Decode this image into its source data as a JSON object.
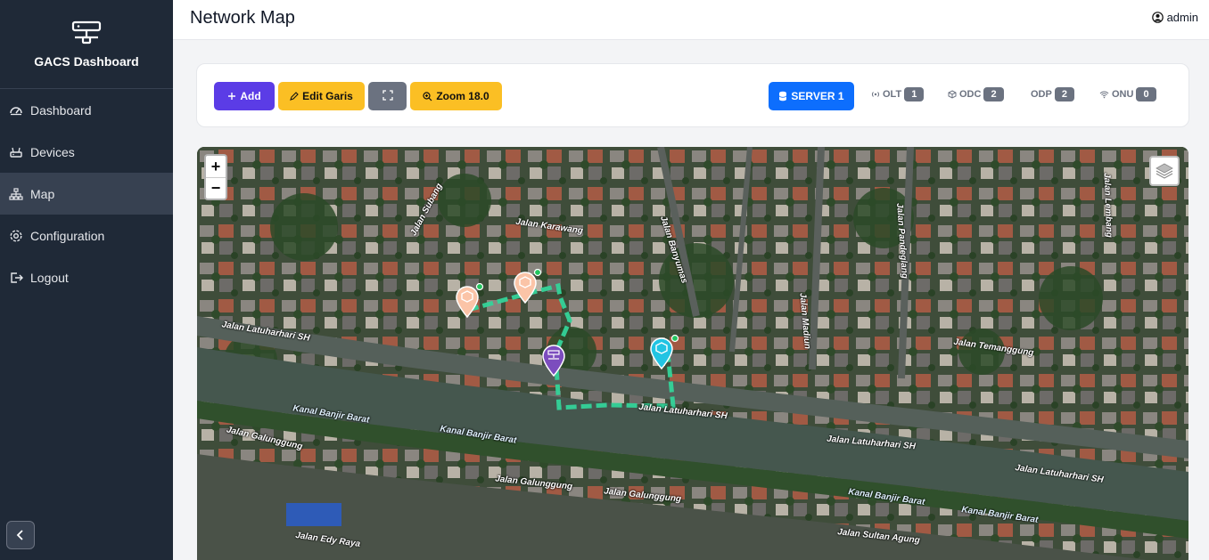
{
  "sidebar": {
    "brand": "GACS Dashboard",
    "items": [
      {
        "label": "Dashboard",
        "icon": "speedometer-icon"
      },
      {
        "label": "Devices",
        "icon": "router-icon"
      },
      {
        "label": "Map",
        "icon": "diagram-icon",
        "active": true
      },
      {
        "label": "Configuration",
        "icon": "gear-icon"
      },
      {
        "label": "Logout",
        "icon": "logout-icon"
      }
    ]
  },
  "header": {
    "title": "Network Map",
    "user": "admin"
  },
  "toolbar": {
    "add_label": "Add",
    "edit_label": "Edit Garis",
    "zoom_label": "Zoom 18.0",
    "server_label": "SERVER 1",
    "stats": [
      {
        "label": "OLT",
        "count": "1"
      },
      {
        "label": "ODC",
        "count": "2"
      },
      {
        "label": "ODP",
        "count": "2"
      },
      {
        "label": "ONU",
        "count": "0"
      }
    ]
  },
  "map": {
    "zoom_in": "+",
    "zoom_out": "−",
    "streets": [
      "Jalan Latuharhari SH",
      "Jalan Latuharhari SH",
      "Kanal Banjir Barat",
      "Kanal Banjir Barat",
      "Jalan Galunggung",
      "Jalan Galunggung",
      "Jalan Galunggung",
      "Jalan Latuharhari SH",
      "Jalan Latuharhari SH",
      "Kanal Banjir Barat",
      "Kanal Banjir Barat",
      "Jalan Sultan Agung",
      "Jalan Temanggung",
      "Jalan Karawang",
      "Jalan Edy Raya",
      "Jalan Madiun",
      "Jalan Banyumas",
      "Jalan Pandeglang",
      "Jalan Subang",
      "Jalan Lembang"
    ],
    "colors": {
      "route": "#34d399",
      "odp": "#fbc4a7",
      "olt": "#7c4dbe",
      "odc": "#22c4e3"
    }
  }
}
